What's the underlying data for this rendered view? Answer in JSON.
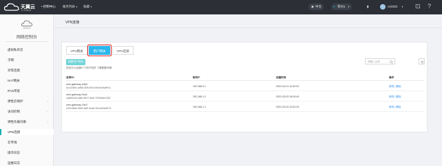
{
  "topbar": {
    "brand_cn": "天翼云",
    "brand_en": "e Cloud",
    "console_link": "• 控制中心",
    "nav": [
      {
        "label": "服务列表"
      },
      {
        "label": "收藏"
      }
    ],
    "language": "中文",
    "region": "贵州1",
    "user": "cs0302",
    "help": "?"
  },
  "sidebar": {
    "title": "网络控制台",
    "items": [
      {
        "label": "虚拟私有云",
        "active": false,
        "arrow": ""
      },
      {
        "label": "子网",
        "active": false,
        "arrow": ""
      },
      {
        "label": "对等连接",
        "active": false,
        "arrow": ""
      },
      {
        "label": "NAT网关",
        "active": false,
        "arrow": ""
      },
      {
        "label": "IPv6带宽",
        "active": false,
        "arrow": ""
      },
      {
        "label": "弹性云保护",
        "active": false,
        "arrow": "›"
      },
      {
        "label": "访问控制",
        "active": false,
        "arrow": "›"
      },
      {
        "label": "弹性负载均衡",
        "active": false,
        "arrow": "›"
      },
      {
        "label": "VPN连接",
        "active": true,
        "arrow": ""
      },
      {
        "label": "云专线",
        "active": false,
        "arrow": ""
      },
      {
        "label": "操作日志",
        "active": false,
        "arrow": ""
      },
      {
        "label": "运维日志",
        "active": false,
        "arrow": ""
      }
    ]
  },
  "page": {
    "title": "VPN连接",
    "tabs": [
      {
        "label": "VPN网关",
        "selected": false
      },
      {
        "label": "用户网关",
        "selected": true
      },
      {
        "label": "VPN连接",
        "selected": false
      }
    ],
    "create_button": "创建用户网关",
    "hint_text": "您还可以创建97个用户网关 了解配额详情",
    "search_placeholder": "请输入名称",
    "columns": [
      "名称/ID",
      "网关IP",
      "创建时间",
      "操作"
    ],
    "rows": [
      {
        "name": "user-gateway-edbd",
        "id": "a1c2c65c-ad58-4f3f-b324-fa51bc6a891c",
        "ip": "192.168.3.1",
        "created": "2021-04-21 14:42:02",
        "ops": "修改 | 删除"
      },
      {
        "name": "user-gateway-9ca4",
        "id": "cd860440-5af6-4b07-8eef-7f245afe1282",
        "ip": "192.168.1.2",
        "created": "2021-03-03 16:03:49",
        "ops": "修改 | 删除"
      },
      {
        "name": "user-gateway-19e3",
        "id": "e43c48ab-9b6f-4af9-9ca8-2b1a349af973",
        "ip": "192.168.1.1",
        "created": "2021-03-03 10:22:23",
        "ops": "修改 | 删除"
      }
    ]
  },
  "colors": {
    "topbar": "#2c2f36",
    "accent": "#29b7ec",
    "highlight": "#e02020",
    "link": "#2d8cf0"
  }
}
